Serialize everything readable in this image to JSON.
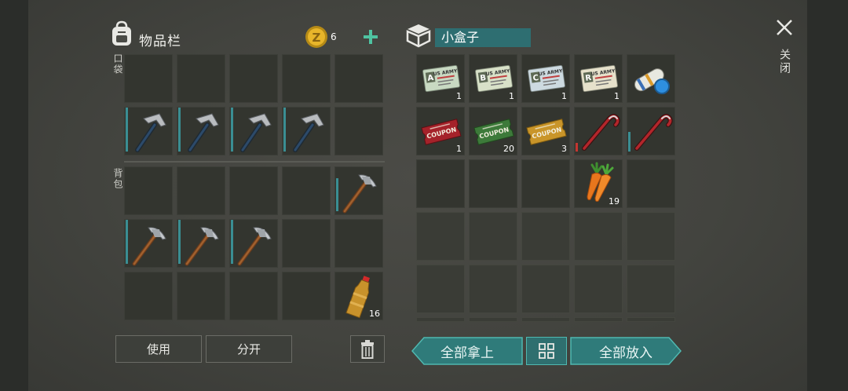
{
  "inventory": {
    "title": "物品栏",
    "coin_count": "6",
    "pocket_label": "口袋",
    "backpack_label": "背包",
    "pocket_slots": [
      {
        "item": "empty"
      },
      {
        "item": "empty"
      },
      {
        "item": "empty"
      },
      {
        "item": "empty"
      },
      {
        "item": "empty"
      },
      {
        "item": "hammer",
        "durability": 1.0
      },
      {
        "item": "hammer",
        "durability": 1.0
      },
      {
        "item": "hammer",
        "durability": 1.0
      },
      {
        "item": "hammer",
        "durability": 1.0
      },
      {
        "item": "empty"
      }
    ],
    "backpack_slots": [
      {
        "item": "empty"
      },
      {
        "item": "empty"
      },
      {
        "item": "empty"
      },
      {
        "item": "empty"
      },
      {
        "item": "pickaxe",
        "durability": 0.75
      },
      {
        "item": "pickaxe",
        "durability": 1.0
      },
      {
        "item": "pickaxe",
        "durability": 1.0
      },
      {
        "item": "pickaxe",
        "durability": 1.0
      },
      {
        "item": "empty"
      },
      {
        "item": "empty"
      },
      {
        "item": "empty"
      },
      {
        "item": "empty"
      },
      {
        "item": "empty"
      },
      {
        "item": "empty"
      },
      {
        "item": "water-bottle",
        "count": "16"
      }
    ],
    "use_button": "使用",
    "split_button": "分开"
  },
  "box": {
    "name": "小盒子",
    "slots": [
      {
        "item": "us-army-card-a",
        "letter": "A",
        "text": "US ARMY",
        "count": "1"
      },
      {
        "item": "us-army-card-b",
        "letter": "B",
        "text": "US ARMY",
        "count": "1"
      },
      {
        "item": "us-army-card-c",
        "letter": "C",
        "text": "US ARMY",
        "count": "1"
      },
      {
        "item": "us-army-card-r",
        "letter": "R",
        "text": "US ARMY",
        "count": "1"
      },
      {
        "item": "blueprint-roll"
      },
      {
        "item": "red-coupon",
        "text": "COUPON",
        "count": "1"
      },
      {
        "item": "green-coupon",
        "text": "COUPON",
        "count": "20"
      },
      {
        "item": "yellow-coupon",
        "text": "COUPON",
        "count": "3"
      },
      {
        "item": "crowbar",
        "durability": 0.2
      },
      {
        "item": "crowbar",
        "durability": 0.45
      },
      {
        "item": "empty"
      },
      {
        "item": "empty"
      },
      {
        "item": "empty"
      },
      {
        "item": "carrot",
        "count": "19"
      },
      {
        "item": "empty"
      }
    ],
    "take_all_button": "全部拿上",
    "put_all_button": "全部放入"
  },
  "close_label": "关闭",
  "colors": {
    "teal": "#2f7b7a",
    "accent_green": "#4fc3a1",
    "durability": "#3a8e93",
    "low_durability": "#c53530"
  }
}
